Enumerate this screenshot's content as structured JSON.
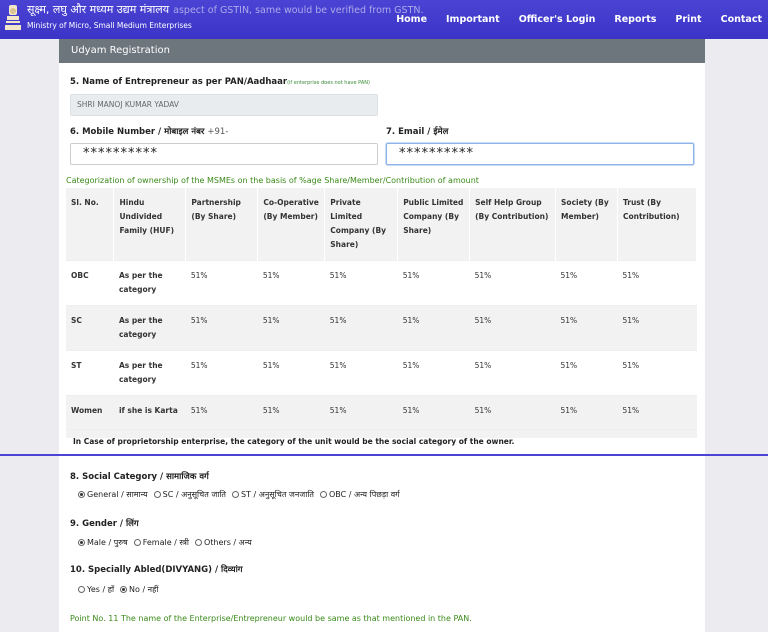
{
  "header": {
    "ministry_hindi": "सूक्ष्म, लघु और मध्यम उद्यम मंत्रालय",
    "overlay_text": "aspect of GSTIN, same would be verified from GSTN.",
    "ministry_english": "Ministry of Micro, Small Medium Enterprises",
    "nav": [
      "Home",
      "Important",
      "Officer's Login",
      "Reports",
      "Print",
      "Contact"
    ]
  },
  "panel": {
    "title": "Udyam Registration"
  },
  "entrepreneur": {
    "label": "5. Name of Entrepreneur as per PAN/Aadhaar",
    "note": "(if enterprise does not have PAN)",
    "value": "SHRI MANOJ KUMAR YADAV"
  },
  "mobile": {
    "label": "6. Mobile Number / मोबाइल नंबर",
    "prefix": "+91-",
    "value": "**********"
  },
  "email": {
    "label": "7. Email / ईमेल",
    "value": "**********"
  },
  "categorization_heading": "Categorization of ownership of the MSMEs on the basis of %age Share/Member/Contribution of amount",
  "ownership_table": {
    "headers": [
      "Sl. No.",
      "Hindu Undivided Family (HUF)",
      "Partnership (By Share)",
      "Co-Operative (By Member)",
      "Private Limited Company (By Share)",
      "Public Limited Company (By Share)",
      "Self Help Group (By Contribution)",
      "Society (By Member)",
      "Trust (By Contribution)"
    ],
    "rows": [
      [
        "OBC",
        "As per the category",
        "51%",
        "51%",
        "51%",
        "51%",
        "51%",
        "51%",
        "51%"
      ],
      [
        "SC",
        "As per the category",
        "51%",
        "51%",
        "51%",
        "51%",
        "51%",
        "51%",
        "51%"
      ],
      [
        "ST",
        "As per the category",
        "51%",
        "51%",
        "51%",
        "51%",
        "51%",
        "51%",
        "51%"
      ],
      [
        "Women",
        "if she is Karta",
        "51%",
        "51%",
        "51%",
        "51%",
        "51%",
        "51%",
        "51%"
      ]
    ],
    "footnote": "In Case of proprietorship enterprise, the category of the unit would be the social category of the owner."
  },
  "social_category": {
    "label": "8. Social Category / सामाजिक वर्ग",
    "options": [
      "General / सामान्य",
      "SC / अनुसूचित जाति",
      "ST / अनुसूचित जनजाति",
      "OBC / अन्य पिछड़ा वर्ग"
    ],
    "selected": "General / सामान्य"
  },
  "gender": {
    "label": "9. Gender / लिंग",
    "options": [
      "Male / पुरुष",
      "Female / स्त्री",
      "Others / अन्य"
    ],
    "selected": "Male / पुरुष"
  },
  "divyang": {
    "label": "10. Specially Abled(DIVYANG) / दिव्यांग",
    "options": [
      "Yes / हाँ",
      "No / नहीं"
    ],
    "selected": "No / नहीं"
  },
  "point11_note": "Point No. 11 The name of the Enterprise/Entrepreneur would be same as that mentioned in the PAN.",
  "colors": {
    "nav_bg": "#3b34c6",
    "panel_head": "#6d757d",
    "green_text": "#3a8a1a"
  }
}
